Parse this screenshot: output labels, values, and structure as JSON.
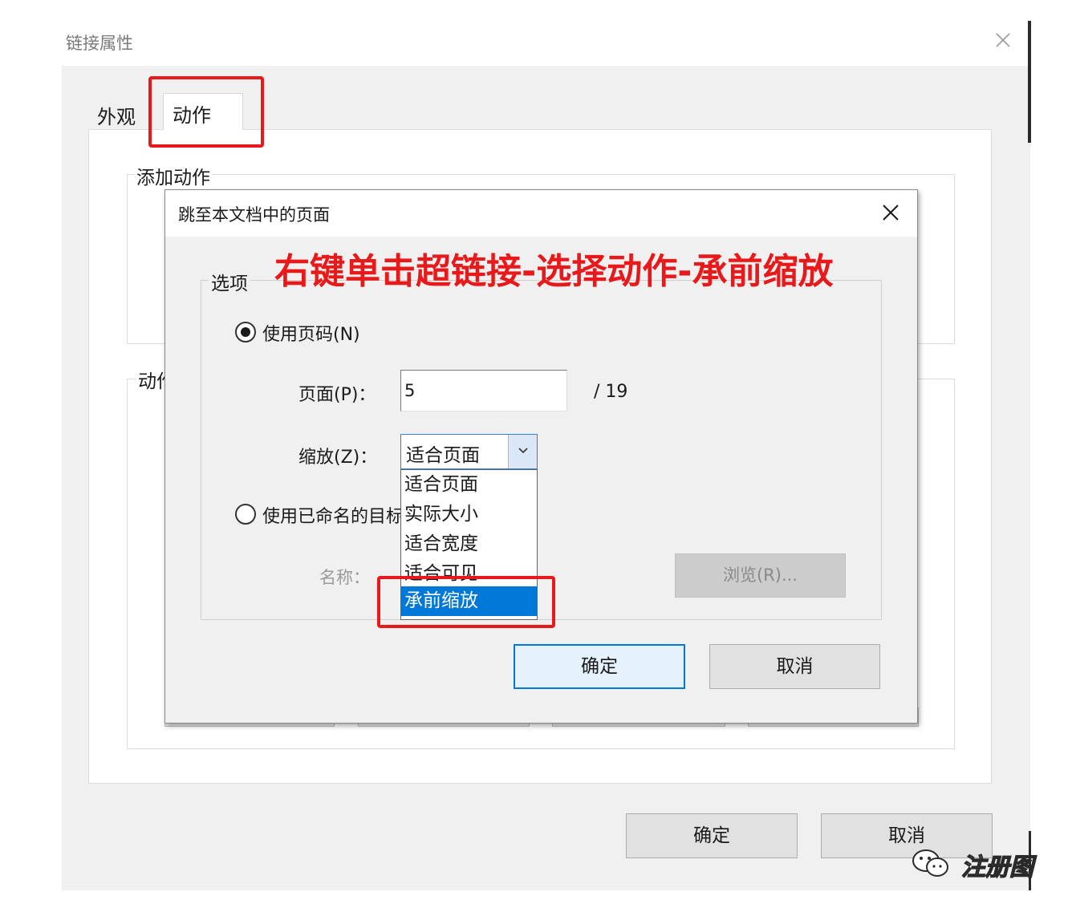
{
  "outer_dialog": {
    "title": "链接属性",
    "tabs": [
      {
        "label": "外观",
        "active": false
      },
      {
        "label": "动作",
        "active": true
      }
    ],
    "add_action_label": "添加动作",
    "actions_label": "动作",
    "ok_label": "确定",
    "cancel_label": "取消"
  },
  "inner_dialog": {
    "title": "跳至本文档中的页面",
    "options_label": "选项",
    "use_page_number_label": "使用页码(N)",
    "page_label": "页面(P)：",
    "page_value": "5",
    "page_total": "/ 19",
    "zoom_label": "缩放(Z)：",
    "zoom_selected": "适合页面",
    "zoom_options": [
      "适合页面",
      "实际大小",
      "适合宽度",
      "适合可见",
      "承前缩放"
    ],
    "zoom_highlighted_index": 4,
    "use_named_dest_label": "使用已命名的目标",
    "name_label": "名称：",
    "browse_label": "浏览(R)...",
    "ok_label": "确定",
    "cancel_label": "取消"
  },
  "annotation": {
    "text": "右键单击超链接-选择动作-承前缩放",
    "color": "#e8191a"
  },
  "watermark": {
    "text": "注册图",
    "icon": "wechat-icon"
  },
  "colors": {
    "highlight": "#0078d7",
    "dialog_bg": "#f0f0f0",
    "annotation_red": "#e8191a"
  }
}
